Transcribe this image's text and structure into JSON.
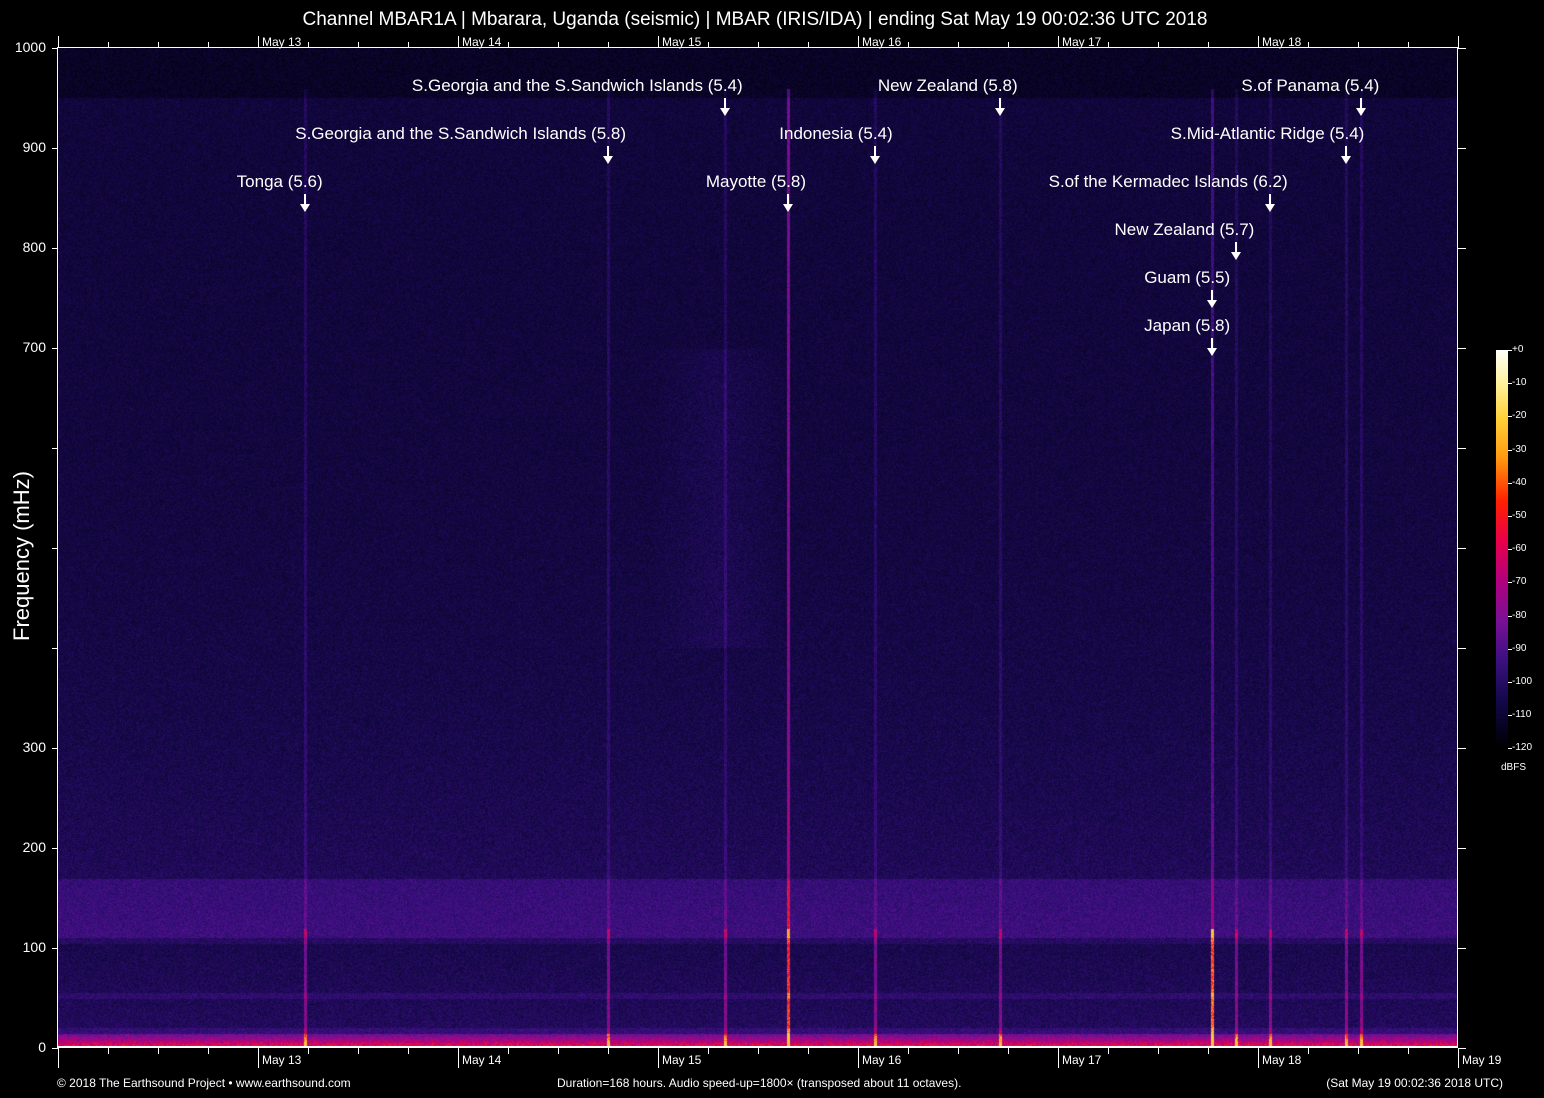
{
  "title": "Channel MBAR1A | Mbarara, Uganda (seismic) | MBAR (IRIS/IDA) | ending Sat May 19 00:02:36 UTC 2018",
  "footer": {
    "left": "© 2018 The Earthsound Project • www.earthsound.com",
    "center": "Duration=168 hours. Audio speed-up=1800× (transposed about 11 octaves).",
    "right": "(Sat May 19 00:02:36 2018 UTC)"
  },
  "colorbar": {
    "unit": "dBFS",
    "ticks": [
      "+0",
      "-10",
      "-20",
      "-30",
      "-40",
      "-50",
      "-60",
      "-70",
      "-80",
      "-90",
      "-100",
      "-110",
      "-120"
    ]
  },
  "chart_data": {
    "type": "heatmap",
    "title": "Channel MBAR1A | Mbarara, Uganda (seismic) | MBAR (IRIS/IDA) | ending Sat May 19 00:02:36 UTC 2018",
    "ylabel": "Frequency (mHz)",
    "ylim": [
      0,
      1000
    ],
    "y_ticks": [
      0,
      100,
      200,
      300,
      400,
      500,
      600,
      700,
      800,
      900,
      1000
    ],
    "y_tick_labels": [
      "0",
      "100",
      "200",
      "300",
      "",
      "",
      "",
      "700",
      "800",
      "900",
      "1000"
    ],
    "x_unit": "hours from start",
    "xlim": [
      0,
      168
    ],
    "x_day_ticks": [
      {
        "label": "May 13",
        "hour": 24
      },
      {
        "label": "May 14",
        "hour": 48
      },
      {
        "label": "May 15",
        "hour": 72
      },
      {
        "label": "May 16",
        "hour": 96
      },
      {
        "label": "May 17",
        "hour": 120
      },
      {
        "label": "May 18",
        "hour": 144
      },
      {
        "label": "May 19",
        "hour": 168
      }
    ],
    "color_scale_dbfs": [
      -120,
      0
    ],
    "events": [
      {
        "label": "Tonga (5.6)",
        "hour": 29.6,
        "row": 2
      },
      {
        "label": "S.Georgia and the S.Sandwich Islands (5.8)",
        "hour": 66.0,
        "row": 1
      },
      {
        "label": "S.Georgia and the S.Sandwich Islands (5.4)",
        "hour": 80.0,
        "row": 0
      },
      {
        "label": "Mayotte (5.8)",
        "hour": 87.6,
        "row": 2
      },
      {
        "label": "Indonesia (5.4)",
        "hour": 98.0,
        "row": 1
      },
      {
        "label": "New Zealand (5.8)",
        "hour": 113.0,
        "row": 0
      },
      {
        "label": "S.of the Kermadec Islands (6.2)",
        "hour": 145.4,
        "row": 2
      },
      {
        "label": "New Zealand (5.7)",
        "hour": 141.4,
        "row": 3
      },
      {
        "label": "Guam (5.5)",
        "hour": 138.5,
        "row": 4
      },
      {
        "label": "Japan (5.8)",
        "hour": 138.5,
        "row": 5
      },
      {
        "label": "S.Mid-Atlantic Ridge (5.4)",
        "hour": 154.6,
        "row": 1
      },
      {
        "label": "S.of Panama (5.4)",
        "hour": 156.4,
        "row": 0
      }
    ]
  }
}
